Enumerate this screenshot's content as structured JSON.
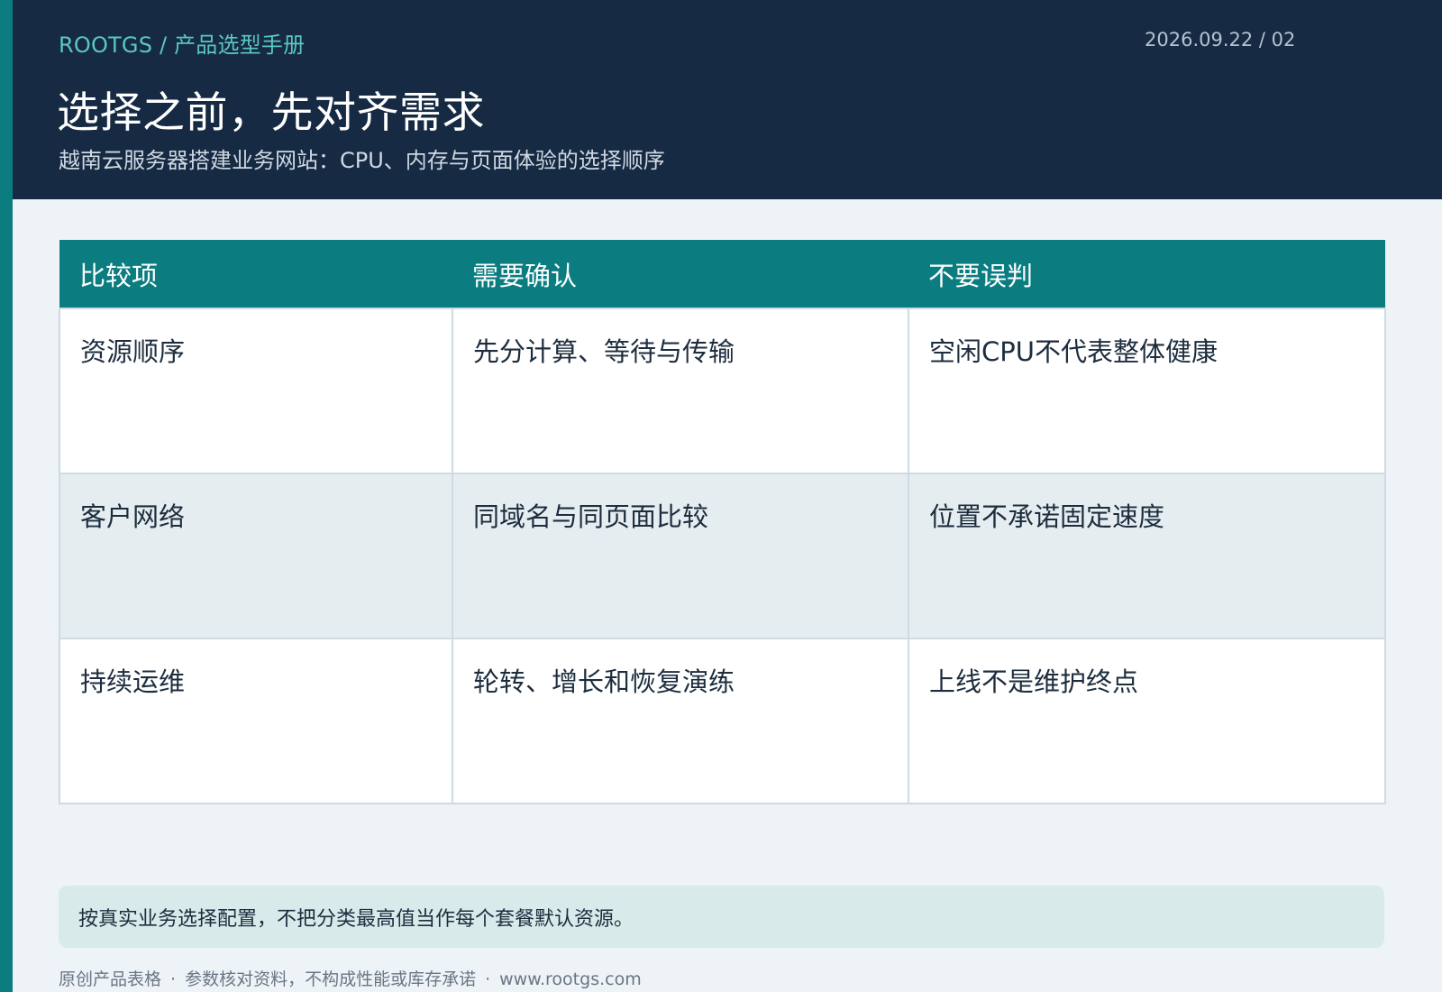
{
  "header": {
    "breadcrumb": "ROOTGS / 产品选型手册",
    "meta": "2026.09.22 / 02",
    "title": "选择之前，先对齐需求",
    "subtitle": "越南云服务器搭建业务网站：CPU、内存与页面体验的选择顺序"
  },
  "table": {
    "columns": [
      "比较项",
      "需要确认",
      "不要误判"
    ],
    "rows": [
      [
        "资源顺序",
        "先分计算、等待与传输",
        "空闲CPU不代表整体健康"
      ],
      [
        "客户网络",
        "同域名与同页面比较",
        "位置不承诺固定速度"
      ],
      [
        "持续运维",
        "轮转、增长和恢复演练",
        "上线不是维护终点"
      ]
    ]
  },
  "note": "按真实业务选择配置，不把分类最高值当作每个套餐默认资源。",
  "footer": {
    "items": [
      "原创产品表格",
      "参数核对资料，不构成性能或库存承诺",
      "www.rootgs.com"
    ],
    "separator": "·"
  },
  "colors": {
    "accent": "#0b7d80",
    "header_bg": "#162a43",
    "breadcrumb": "#5ac7c3",
    "page_bg": "#eef3f7",
    "alt_row": "#e5edf1",
    "note_bg": "#d8eaea"
  }
}
